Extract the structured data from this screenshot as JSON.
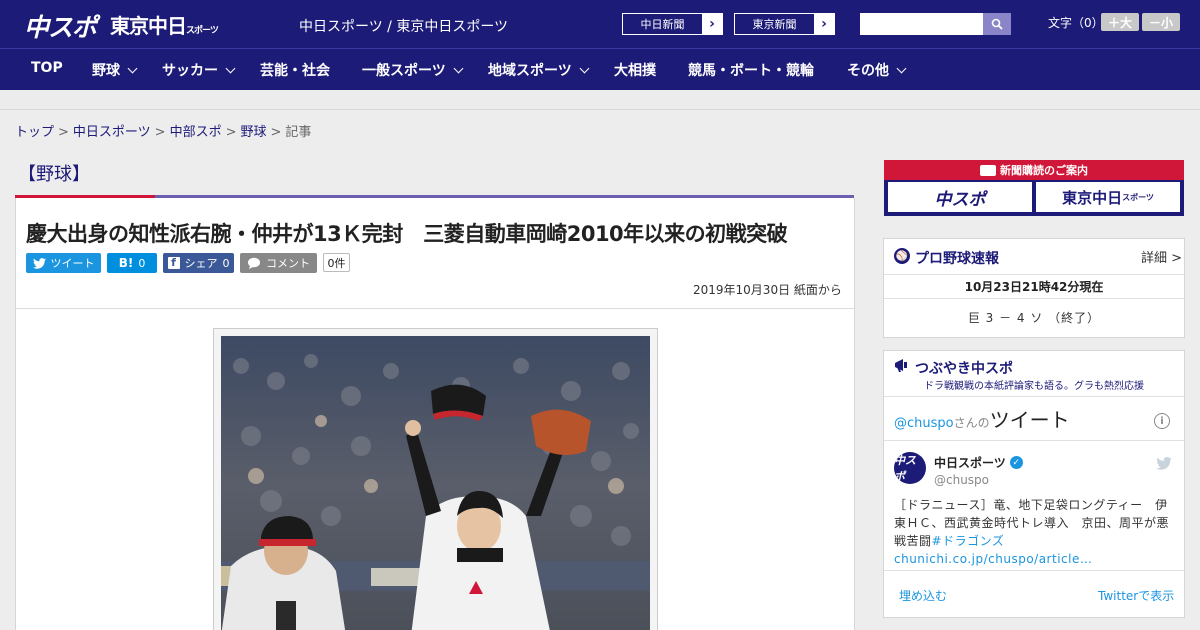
{
  "header": {
    "logo_chuspo": "中スポ",
    "logo_tokyo": "東京中日",
    "logo_tokyo_small": "スポーツ",
    "tagline": "中日スポーツ / 東京中日スポーツ",
    "paper_links": [
      {
        "label": "中日新聞"
      },
      {
        "label": "東京新聞"
      }
    ],
    "search": {
      "value": "",
      "placeholder": ""
    },
    "font_size": {
      "label": "文字（0）",
      "increase": "＋大",
      "decrease": "－小"
    }
  },
  "nav": {
    "items": [
      {
        "label": "TOP",
        "has_dropdown": false
      },
      {
        "label": "野球",
        "has_dropdown": true
      },
      {
        "label": "サッカー",
        "has_dropdown": true
      },
      {
        "label": "芸能・社会",
        "has_dropdown": false
      },
      {
        "label": "一般スポーツ",
        "has_dropdown": true
      },
      {
        "label": "地域スポーツ",
        "has_dropdown": true
      },
      {
        "label": "大相撲",
        "has_dropdown": false
      },
      {
        "label": "競馬・ボート・競輪",
        "has_dropdown": false
      },
      {
        "label": "その他",
        "has_dropdown": true
      }
    ]
  },
  "breadcrumb": {
    "items": [
      "トップ",
      "中日スポーツ",
      "中部スポ",
      "野球"
    ],
    "current": "記事",
    "separator": ">"
  },
  "article": {
    "category": "【野球】",
    "headline": "慶大出身の知性派右腕・仲井が13Ｋ完封　三菱自動車岡崎2010年以来の初戦突破",
    "share": {
      "tweet": "ツイート",
      "hatena": "B!",
      "hatena_count": "0",
      "facebook": "シェア",
      "facebook_count": "0",
      "comment": "コメント",
      "comment_count": "0件"
    },
    "date": "2019年10月30日 紙面から"
  },
  "sidebar": {
    "subscription": {
      "header": "新聞購読のご案内",
      "logo_chuspo": "中スポ",
      "logo_tokyo": "東京中日",
      "logo_tokyo_small": "スポーツ"
    },
    "baseball": {
      "title": "プロ野球速報",
      "detail": "詳細 >",
      "timestamp": "10月23日21時42分現在",
      "score": "巨 3 － 4 ソ （終了）"
    },
    "twitter": {
      "title": "つぶやき中スポ",
      "subtitle": "ドラ戦観戦の本紙評論家も語る。グラも熱烈応援",
      "handle_line": "@chuspo",
      "handle_suffix": "さんの",
      "tweets_word": "ツイート",
      "account_name": "中日スポーツ",
      "account_handle": "@chuspo",
      "avatar_text": "中スポ",
      "tweet_text_main": "［ドラニュース］竜、地下足袋ロングティー　伊東ＨＣ、西武黄金時代トレ導入　京田、周平が悪戦苦闘",
      "tweet_text_link": "#ドラゴンズchunichi.co.jp/chuspo/article…",
      "embed": "埋め込む",
      "view_on": "Twitterで表示"
    }
  },
  "colors": {
    "brand": "#1d1b78",
    "accent_red": "#d0173a",
    "twitter_blue": "#1b95e0",
    "facebook": "#3b5998",
    "hatena": "#008fde"
  }
}
